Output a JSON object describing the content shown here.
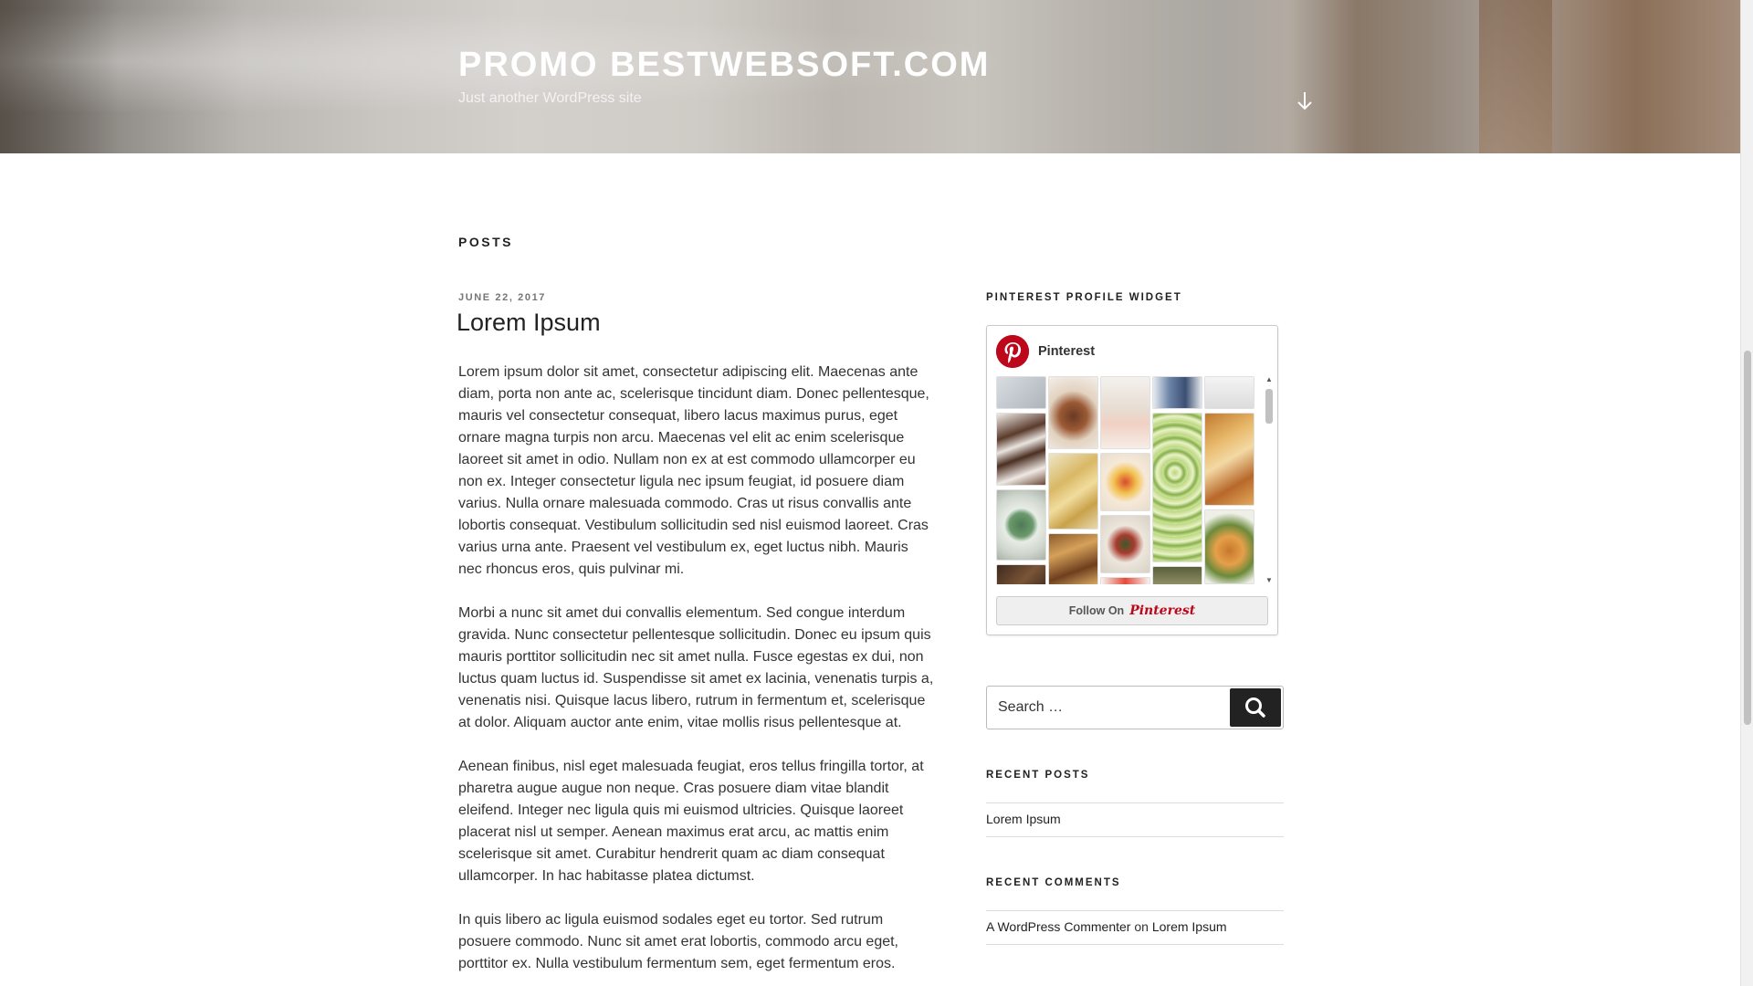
{
  "header": {
    "site_title": "PROMO BESTWEBSOFT.COM",
    "tagline": "Just another WordPress site"
  },
  "main": {
    "heading": "POSTS",
    "post": {
      "date": "JUNE 22, 2017",
      "title": "Lorem Ipsum",
      "paragraphs": [
        "Lorem ipsum dolor sit amet, consectetur adipiscing elit. Maecenas ante diam, porta non ante ac, scelerisque tincidunt diam. Donec pellentesque, mauris vel consectetur consequat, libero lacus maximus purus, eget ornare magna turpis non arcu. Maecenas vel elit ac enim scelerisque laoreet sit amet in odio. Nullam non ex at est commodo ullamcorper eu non ex. Integer consectetur ligula nec ipsum feugiat, id posuere diam varius. Nulla ornare malesuada commodo. Cras ut risus convallis ante lobortis consequat. Vestibulum sollicitudin sed nisl euismod laoreet. Cras varius urna ante. Praesent vel vestibulum ex, eget luctus nibh. Mauris nec rhoncus eros, quis pulvinar mi.",
        "Morbi a nunc sit amet dui convallis elementum. Sed congue interdum gravida. Nunc consectetur pellentesque sollicitudin. Donec eu ipsum quis mauris porttitor sollicitudin nec sit amet nulla. Fusce egestas ex dui, non luctus quam luctus id. Suspendisse sit amet ex lacinia, venenatis turpis a, venenatis nisi. Quisque lacus libero, rutrum in fermentum et, scelerisque at dolor. Aliquam auctor ante enim, vitae mollis risus pellentesque at.",
        "Aenean finibus, nisl eget malesuada feugiat, eros tellus fringilla tortor, at pharetra augue augue non neque. Cras posuere diam vitae blandit eleifend. Integer nec ligula quis mi euismod ultricies. Quisque laoreet placerat nisl ut semper. Aenean maximus erat arcu, ac mattis enim scelerisque sit amet. Curabitur hendrerit quam ac diam consequat ullamcorper. In hac habitasse platea dictumst.",
        "In quis libero ac ligula euismod sodales eget eu tortor. Sed rutrum posuere commodo. Nunc sit amet erat lobortis, commodo arcu eget, porttitor ex. Nulla vestibulum fermentum sem, eget fermentum eros."
      ]
    }
  },
  "sidebar": {
    "pinterest": {
      "widget_title": "PINTEREST PROFILE WIDGET",
      "profile_name": "Pinterest",
      "follow_label": "Follow On",
      "follow_brand": "Pinterest",
      "brand_color": "#bd081c"
    },
    "search": {
      "placeholder": "Search …",
      "button_icon": "search-icon"
    },
    "recent_posts": {
      "title": "RECENT POSTS",
      "items": [
        "Lorem Ipsum"
      ]
    },
    "recent_comments": {
      "title": "RECENT COMMENTS",
      "items": [
        {
          "author": "A WordPress Commenter",
          "connector": "on",
          "post": "Lorem Ipsum"
        }
      ]
    }
  }
}
